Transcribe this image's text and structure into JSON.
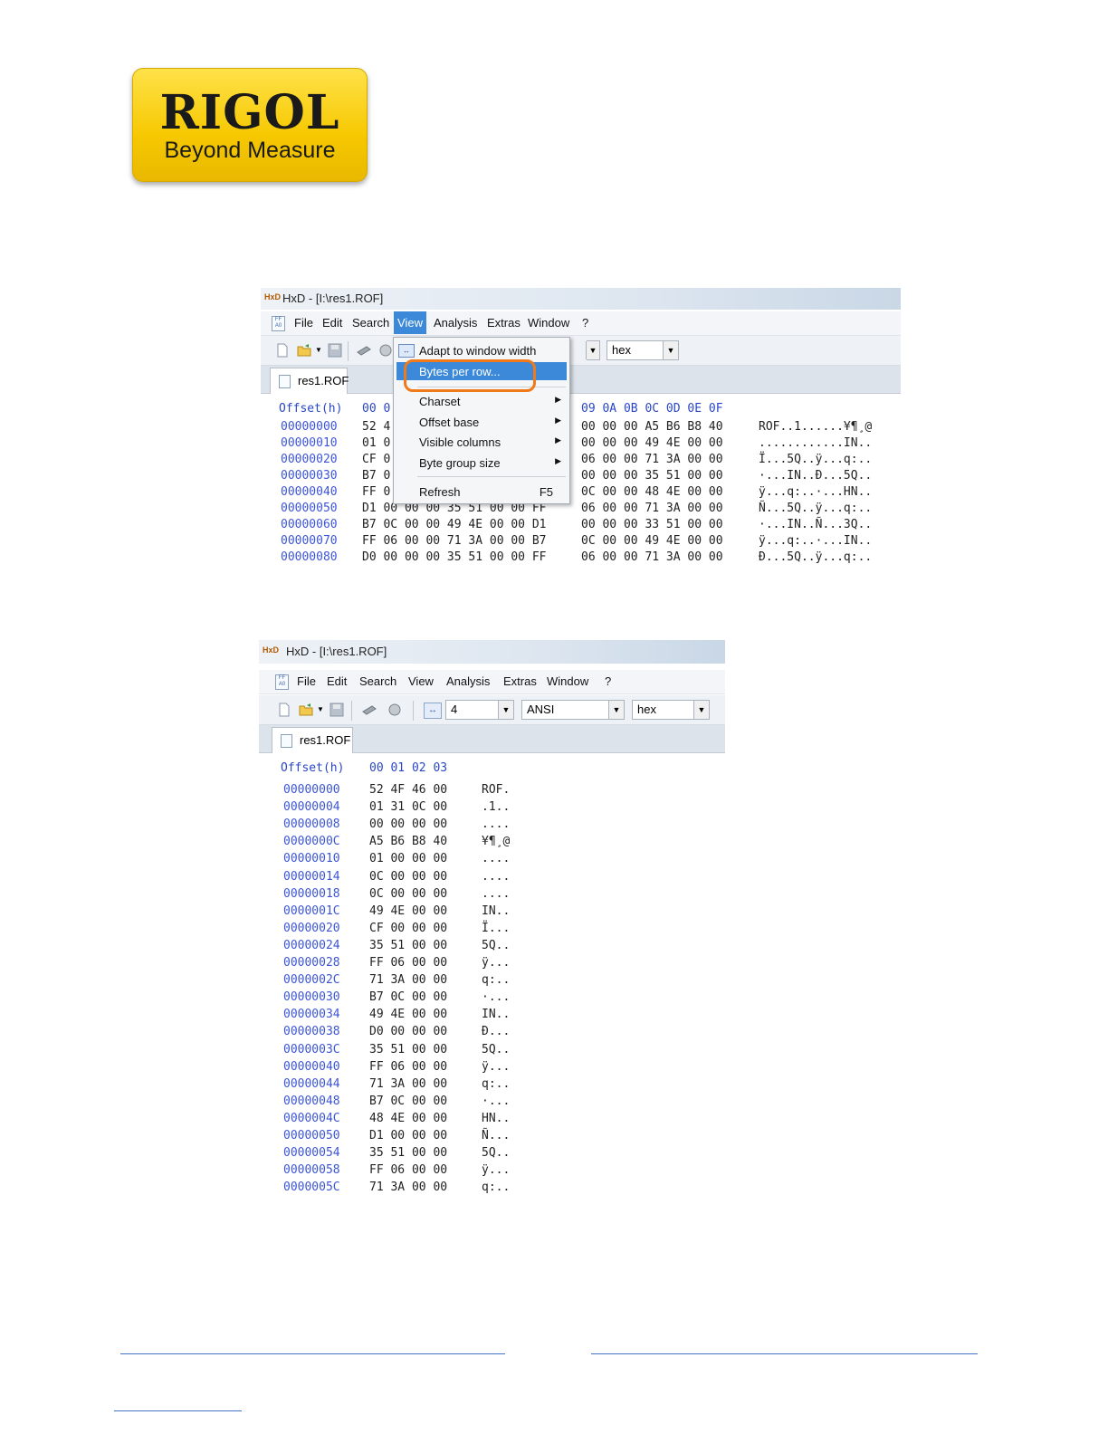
{
  "logo": {
    "brand": "RIGOL",
    "tagline": "Beyond Measure"
  },
  "window1": {
    "title": "HxD - [I:\\res1.ROF]",
    "menu": [
      "File",
      "Edit",
      "Search",
      "View",
      "Analysis",
      "Extras",
      "Window",
      "?"
    ],
    "active_menu": "View",
    "toolbar": {
      "base_value": "hex"
    },
    "tab": "res1.ROF",
    "header": {
      "offset_label": "Offset(h)",
      "columns_left": "00 0",
      "columns_right": "09 0A 0B 0C 0D 0E 0F"
    },
    "rows": [
      {
        "offset": "00000000",
        "left": "52 4",
        "right": "00 00 00 A5 B6 B8 40",
        "ascii": "ROF..1......¥¶¸@"
      },
      {
        "offset": "00000010",
        "left": "01 0",
        "right": "00 00 00 49 4E 00 00",
        "ascii": "............IN.."
      },
      {
        "offset": "00000020",
        "left": "CF 0",
        "right": "06 00 00 71 3A 00 00",
        "ascii": "Ï...5Q..ÿ...q:.."
      },
      {
        "offset": "00000030",
        "left": "B7 0",
        "right": "00 00 00 35 51 00 00",
        "ascii": "·...IN..Ð...5Q.."
      },
      {
        "offset": "00000040",
        "left": "FF 0",
        "right": "0C 00 00 48 4E 00 00",
        "ascii": "ÿ...q:..·...HN.."
      },
      {
        "offset": "00000050",
        "left": "D1 00 00 00 35 51 00 00 FF",
        "right": "06 00 00 71 3A 00 00",
        "ascii": "Ñ...5Q..ÿ...q:.."
      },
      {
        "offset": "00000060",
        "left": "B7 0C 00 00 49 4E 00 00 D1",
        "right": "00 00 00 33 51 00 00",
        "ascii": "·...IN..Ñ...3Q.."
      },
      {
        "offset": "00000070",
        "left": "FF 06 00 00 71 3A 00 00 B7",
        "right": "0C 00 00 49 4E 00 00",
        "ascii": "ÿ...q:..·...IN.."
      },
      {
        "offset": "00000080",
        "left": "D0 00 00 00 35 51 00 00 FF",
        "right": "06 00 00 71 3A 00 00",
        "ascii": "Ð...5Q..ÿ...q:.."
      }
    ],
    "view_menu": {
      "items": [
        {
          "label": "Adapt to window width",
          "icon": "adapt-width-icon"
        },
        {
          "label": "Bytes per row...",
          "highlighted": true
        },
        {
          "label": "Charset",
          "submenu": true
        },
        {
          "label": "Offset base",
          "submenu": true
        },
        {
          "label": "Visible columns",
          "submenu": true
        },
        {
          "label": "Byte group size",
          "submenu": true
        },
        {
          "label": "Refresh",
          "shortcut": "F5"
        }
      ]
    }
  },
  "window2": {
    "title": "HxD - [I:\\res1.ROF]",
    "menu": [
      "File",
      "Edit",
      "Search",
      "View",
      "Analysis",
      "Extras",
      "Window",
      "?"
    ],
    "toolbar": {
      "bytes_per_row": "4",
      "charset": "ANSI",
      "base": "hex"
    },
    "tab": "res1.ROF",
    "header": {
      "offset_label": "Offset(h)",
      "columns": "00 01 02 03"
    },
    "rows": [
      {
        "offset": "00000000",
        "bytes": "52 4F 46 00",
        "ascii": "ROF."
      },
      {
        "offset": "00000004",
        "bytes": "01 31 0C 00",
        "ascii": ".1.."
      },
      {
        "offset": "00000008",
        "bytes": "00 00 00 00",
        "ascii": "...."
      },
      {
        "offset": "0000000C",
        "bytes": "A5 B6 B8 40",
        "ascii": "¥¶¸@"
      },
      {
        "offset": "00000010",
        "bytes": "01 00 00 00",
        "ascii": "...."
      },
      {
        "offset": "00000014",
        "bytes": "0C 00 00 00",
        "ascii": "...."
      },
      {
        "offset": "00000018",
        "bytes": "0C 00 00 00",
        "ascii": "...."
      },
      {
        "offset": "0000001C",
        "bytes": "49 4E 00 00",
        "ascii": "IN.."
      },
      {
        "offset": "00000020",
        "bytes": "CF 00 00 00",
        "ascii": "Ï..."
      },
      {
        "offset": "00000024",
        "bytes": "35 51 00 00",
        "ascii": "5Q.."
      },
      {
        "offset": "00000028",
        "bytes": "FF 06 00 00",
        "ascii": "ÿ..."
      },
      {
        "offset": "0000002C",
        "bytes": "71 3A 00 00",
        "ascii": "q:.."
      },
      {
        "offset": "00000030",
        "bytes": "B7 0C 00 00",
        "ascii": "·..."
      },
      {
        "offset": "00000034",
        "bytes": "49 4E 00 00",
        "ascii": "IN.."
      },
      {
        "offset": "00000038",
        "bytes": "D0 00 00 00",
        "ascii": "Ð..."
      },
      {
        "offset": "0000003C",
        "bytes": "35 51 00 00",
        "ascii": "5Q.."
      },
      {
        "offset": "00000040",
        "bytes": "FF 06 00 00",
        "ascii": "ÿ..."
      },
      {
        "offset": "00000044",
        "bytes": "71 3A 00 00",
        "ascii": "q:.."
      },
      {
        "offset": "00000048",
        "bytes": "B7 0C 00 00",
        "ascii": "·..."
      },
      {
        "offset": "0000004C",
        "bytes": "48 4E 00 00",
        "ascii": "HN.."
      },
      {
        "offset": "00000050",
        "bytes": "D1 00 00 00",
        "ascii": "Ñ..."
      },
      {
        "offset": "00000054",
        "bytes": "35 51 00 00",
        "ascii": "5Q.."
      },
      {
        "offset": "00000058",
        "bytes": "FF 06 00 00",
        "ascii": "ÿ..."
      },
      {
        "offset": "0000005C",
        "bytes": "71 3A 00 00",
        "ascii": "q:.."
      }
    ]
  },
  "colors": {
    "offset_blue": "#3c55d8",
    "menu_highlight": "#3b89d8",
    "callout_orange": "#f07a1a",
    "logo_yellow": "#f6c800"
  }
}
